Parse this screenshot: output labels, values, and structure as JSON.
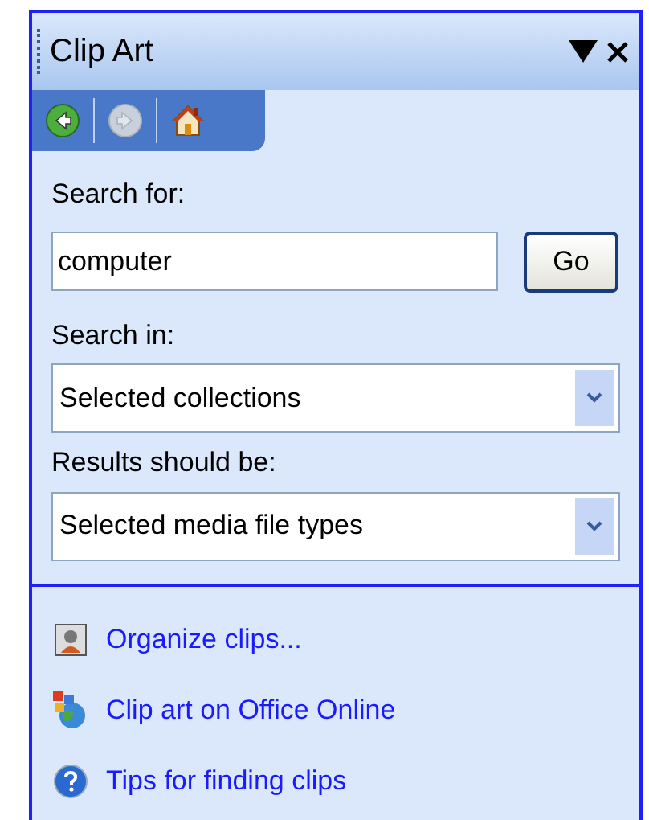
{
  "pane": {
    "title": "Clip Art"
  },
  "nav": [
    {
      "kind": "back",
      "disabled": false
    },
    {
      "kind": "forward",
      "disabled": true
    },
    {
      "kind": "home",
      "disabled": false
    }
  ],
  "search_for": {
    "label": "Search for:",
    "value": "computer",
    "button": "Go"
  },
  "search_in": {
    "label": "Search in:",
    "value": "Selected collections"
  },
  "results": {
    "label": "Results should be:",
    "value": "Selected media file types"
  },
  "links": [
    {
      "kind": "organize",
      "label": "Organize clips..."
    },
    {
      "kind": "online",
      "label": "Clip art on Office Online"
    },
    {
      "kind": "tips",
      "label": "Tips for finding clips"
    }
  ]
}
